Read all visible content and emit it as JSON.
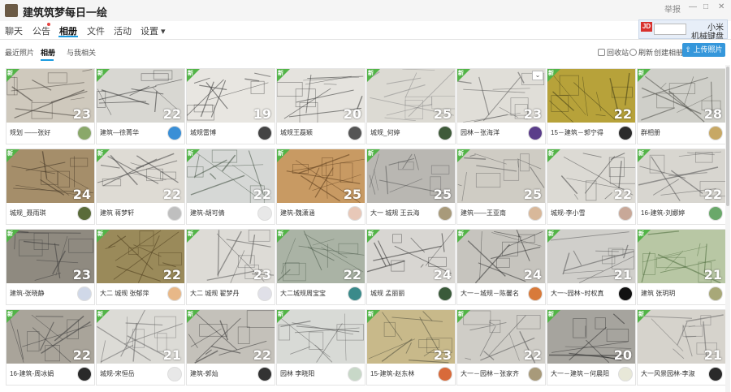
{
  "window": {
    "title": "建筑筑梦每日一绘",
    "controls": [
      "举报",
      "—",
      "□",
      "✕"
    ]
  },
  "ad": {
    "badge": "JD",
    "line1": "小米",
    "line2": "机械键盘"
  },
  "tabs": [
    {
      "label": "聊天",
      "active": false
    },
    {
      "label": "公告",
      "active": false,
      "dot": true
    },
    {
      "label": "相册",
      "active": true
    },
    {
      "label": "文件",
      "active": false
    },
    {
      "label": "活动",
      "active": false
    },
    {
      "label": "设置 ▾",
      "active": false
    }
  ],
  "subtabs": [
    {
      "label": "最近照片",
      "active": false
    },
    {
      "label": "相册",
      "active": true
    },
    {
      "label": "与我相关",
      "active": false
    }
  ],
  "tools": {
    "recycle": "回收站",
    "refresh": "刷新",
    "create": "创建相册",
    "upload": "上传照片"
  },
  "badge_text": "新",
  "albums": [
    {
      "caption": "规划 ——张好",
      "count": "23",
      "bg": "#cfc9bd",
      "ink": "#3b3631",
      "av": "#8aa86a"
    },
    {
      "caption": "建筑—徐菁华",
      "count": "22",
      "bg": "#d8d7d2",
      "ink": "#2b2b2b",
      "av": "#3a8fd6"
    },
    {
      "caption": "城规雷博",
      "count": "19",
      "bg": "#e8e6e1",
      "ink": "#333333",
      "av": "#444444"
    },
    {
      "caption": "城规王磊颖",
      "count": "20",
      "bg": "#e5e3de",
      "ink": "#333333",
      "av": "#555555"
    },
    {
      "caption": "城规_何婷",
      "count": "25",
      "bg": "#dcdad3",
      "ink": "#888888",
      "av": "#3f5b3a"
    },
    {
      "caption": "园林－张海洋",
      "count": "23",
      "bg": "#e0ded8",
      "ink": "#555555",
      "av": "#5a3d8a"
    },
    {
      "caption": "15－建筑－郭宁得",
      "count": "22",
      "bg": "#b7a23a",
      "ink": "#3d3a14",
      "av": "#2b2b2b"
    },
    {
      "caption": "群相册",
      "count": "28",
      "bg": "#cfcfc9",
      "ink": "#4a4a44",
      "av": "#c7a865"
    },
    {
      "caption": "城规_聂雨琪",
      "count": "24",
      "bg": "#a58e6a",
      "ink": "#3b2f20",
      "av": "#5a6b3a"
    },
    {
      "caption": "建筑 蒋梦轩",
      "count": "22",
      "bg": "#dedbd4",
      "ink": "#444444",
      "av": "#bfbfbf"
    },
    {
      "caption": "建筑-胡可倩",
      "count": "22",
      "bg": "#d6d8d6",
      "ink": "#3a4a3a",
      "av": "#e8e8e8"
    },
    {
      "caption": "建筑-魏潇涵",
      "count": "25",
      "bg": "#c89a63",
      "ink": "#5a3a1a",
      "av": "#e8c8b8"
    },
    {
      "caption": "大一 城规 王云海",
      "count": "25",
      "bg": "#b9b7b2",
      "ink": "#555555",
      "av": "#a89a7a"
    },
    {
      "caption": "建筑——王亚南",
      "count": "25",
      "bg": "#cfccc4",
      "ink": "#555555",
      "av": "#d8b89a"
    },
    {
      "caption": "城规-李小雪",
      "count": "22",
      "bg": "#dcdad4",
      "ink": "#444444",
      "av": "#c8a898"
    },
    {
      "caption": "16-建筑-刘娜婷",
      "count": "22",
      "bg": "#d8d6d0",
      "ink": "#555555",
      "av": "#6aa86a"
    },
    {
      "caption": "建筑-张晓静",
      "count": "23",
      "bg": "#8f8a80",
      "ink": "#3a3a3a",
      "av": "#d0d8e8"
    },
    {
      "caption": "大二 城规 张郁萍",
      "count": "22",
      "bg": "#9a8a5a",
      "ink": "#4a3a1a",
      "av": "#e8b888"
    },
    {
      "caption": "大二 城规 翟梦丹",
      "count": "23",
      "bg": "#dddbd6",
      "ink": "#555555",
      "av": "#e0e0e8"
    },
    {
      "caption": "大二城规周宝宝",
      "count": "22",
      "bg": "#aab3a5",
      "ink": "#4a5a4a",
      "av": "#3a8a8a"
    },
    {
      "caption": "城规 孟丽丽",
      "count": "24",
      "bg": "#d8d6d2",
      "ink": "#2a2a2a",
      "av": "#3a5a3a"
    },
    {
      "caption": "大一－城规－陈馨名",
      "count": "24",
      "bg": "#c6c4be",
      "ink": "#333333",
      "av": "#d87a3a"
    },
    {
      "caption": "大一~园林~时权真",
      "count": "21",
      "bg": "#d0cfcb",
      "ink": "#555555",
      "av": "#111111"
    },
    {
      "caption": "建筑 张玥玥",
      "count": "21",
      "bg": "#b8c7a4",
      "ink": "#4a6a3a",
      "av": "#a8a878"
    },
    {
      "caption": "16-建筑-周冰娟",
      "count": "22",
      "bg": "#a9a49a",
      "ink": "#3a3a3a",
      "av": "#2a2a2a"
    },
    {
      "caption": "城规-宋恒岳",
      "count": "21",
      "bg": "#dcdbd6",
      "ink": "#666666",
      "av": "#e8e8e8"
    },
    {
      "caption": "建筑-郭灿",
      "count": "22",
      "bg": "#c4c1ba",
      "ink": "#333333",
      "av": "#333333"
    },
    {
      "caption": "园林 李晓阳",
      "count": "",
      "bg": "#d8dad6",
      "ink": "#555555",
      "av": "#c8d8c8"
    },
    {
      "caption": "15-建筑-赵东林",
      "count": "23",
      "bg": "#c8b98a",
      "ink": "#4a4a3a",
      "av": "#d86a3a"
    },
    {
      "caption": "大一－园林－张家齐",
      "count": "22",
      "bg": "#cfcdc7",
      "ink": "#555555",
      "av": "#a89a7a"
    },
    {
      "caption": "大一－建筑－何晨阳",
      "count": "20",
      "bg": "#a6a49e",
      "ink": "#2a2a2a",
      "av": "#e8e8d8"
    },
    {
      "caption": "大一风景园林-李淑",
      "count": "21",
      "bg": "#d6d3cc",
      "ink": "#666666",
      "av": "#2a2a2a"
    }
  ]
}
